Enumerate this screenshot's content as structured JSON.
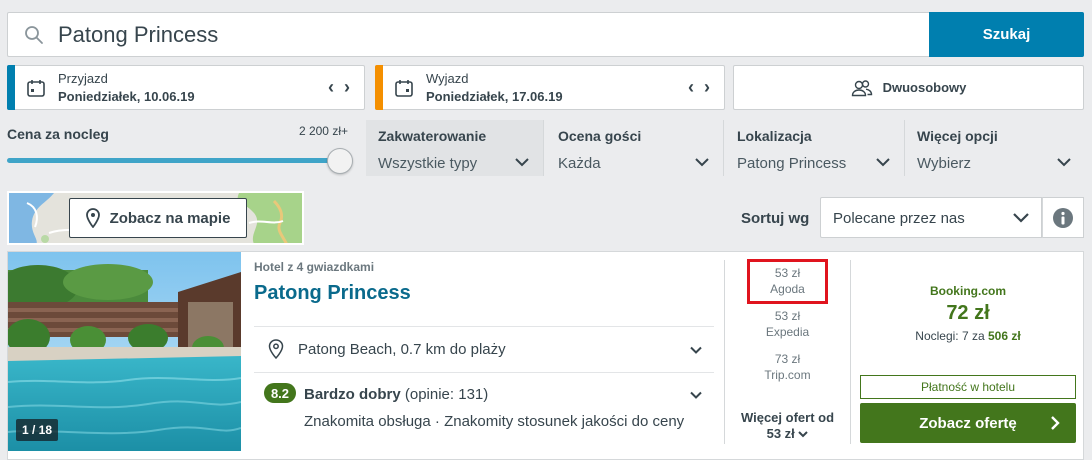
{
  "search": {
    "value": "Patong Princess",
    "button_label": "Szukaj"
  },
  "checkin": {
    "label": "Przyjazd",
    "value": "Poniedziałek, 10.06.19",
    "accent_color": "#007faf"
  },
  "checkout": {
    "label": "Wyjazd",
    "value": "Poniedziałek, 17.06.19",
    "accent_color": "#f48f00"
  },
  "guests": {
    "label": "Dwuosobowy"
  },
  "filters": {
    "price": {
      "title": "Cena za nocleg",
      "max_label": "2 200 zł+",
      "slider_fraction": 1.0
    },
    "accommodation": {
      "title": "Zakwaterowanie",
      "value": "Wszystkie typy"
    },
    "rating": {
      "title": "Ocena gości",
      "value": "Każda"
    },
    "location": {
      "title": "Lokalizacja",
      "value": "Patong Princess"
    },
    "more": {
      "title": "Więcej opcji",
      "value": "Wybierz"
    }
  },
  "map": {
    "button_label": "Zobacz na mapie"
  },
  "sort": {
    "label": "Sortuj wg",
    "value": "Polecane przez nas"
  },
  "result": {
    "photo_counter": "1 / 18",
    "hotel_type": "Hotel z 4 gwiazdkami",
    "name": "Patong Princess",
    "location": "Patong Beach, 0.7 km do plaży",
    "rating_score": "8.2",
    "rating_label": "Bardzo dobry",
    "rating_count": "(opinie: 131)",
    "rating_highlights": "Znakomita obsługa · Znakomity stosunek jakości do ceny",
    "offers": [
      {
        "price": "53 zł",
        "site": "Agoda"
      },
      {
        "price": "53 zł",
        "site": "Expedia"
      },
      {
        "price": "73 zł",
        "site": "Trip.com"
      }
    ],
    "more_offers_line1": "Więcej ofert od",
    "more_offers_line2": "53 zł",
    "deal": {
      "site": "Booking.com",
      "price": "72 zł",
      "nights_prefix": "Noclegi: 7 za",
      "nights_total": "506 zł",
      "pay_at_hotel": "Płatność w hotelu",
      "button_label": "Zobacz ofertę"
    }
  },
  "colors": {
    "primary_blue": "#007faf",
    "deal_green": "#43761c",
    "highlight_red": "#e0141e"
  }
}
